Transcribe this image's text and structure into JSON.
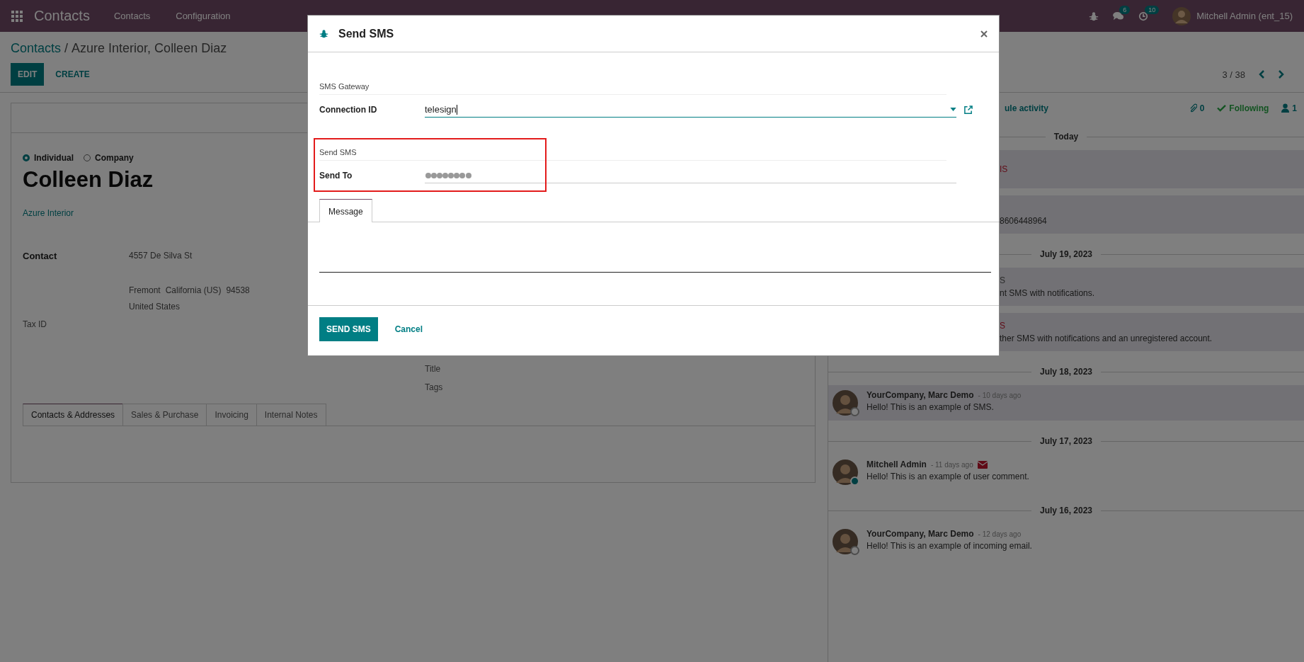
{
  "navbar": {
    "app_name": "Contacts",
    "menus": [
      "Contacts",
      "Configuration"
    ],
    "messages_count": "6",
    "activities_count": "10",
    "user_name": "Mitchell Admin (ent_15)"
  },
  "breadcrumb": {
    "parent": "Contacts",
    "separator": "/",
    "current": "Azure Interior, Colleen Diaz"
  },
  "actions": [
    {
      "label": "EDIT",
      "kind": "primary"
    },
    {
      "label": "CREATE",
      "kind": "link"
    }
  ],
  "pager": {
    "text": "3 / 38"
  },
  "form": {
    "company_type": [
      {
        "label": "Individual",
        "selected": true
      },
      {
        "label": "Company",
        "selected": false
      }
    ],
    "name": "Colleen Diaz",
    "parent_company": "Azure Interior",
    "address_label": "Contact",
    "address": {
      "street": "4557 De Silva St",
      "city": "Fremont",
      "state": "California (US)",
      "zip": "94538",
      "country": "United States"
    },
    "tax_label": "Tax ID",
    "right_labels": [
      "Title",
      "Tags"
    ],
    "tabs": [
      {
        "label": "Contacts & Addresses",
        "selected": true
      },
      {
        "label": "Sales & Purchase",
        "selected": false
      },
      {
        "label": "Invoicing",
        "selected": false
      },
      {
        "label": "Internal Notes",
        "selected": false
      }
    ]
  },
  "chatter": {
    "action_fragment": "ule activity",
    "attachments": "0",
    "follow_label": "Following",
    "followers": "1",
    "groups": [
      {
        "date": "Today",
        "messages": [
          {
            "kind": "fragment",
            "author_fragment": "IS",
            "failed": true,
            "shaded": true
          },
          {
            "kind": "fragment",
            "body_fragment": "8606448964",
            "shaded": true
          }
        ]
      },
      {
        "date": "July 19, 2023",
        "messages": [
          {
            "kind": "fragment",
            "author_fragment": "S",
            "failed": false,
            "body_fragment": "nt SMS with notifications.",
            "shaded": true
          },
          {
            "kind": "fragment",
            "author_fragment": "S",
            "failed": true,
            "body_fragment": "ther SMS with notifications and an unregistered account.",
            "shaded": true
          }
        ]
      },
      {
        "date": "July 18, 2023",
        "messages": [
          {
            "kind": "message",
            "author": "YourCompany, Marc Demo",
            "date": "- 10 days ago",
            "body": "Hello! This is an example of SMS.",
            "online": false,
            "shaded": true
          }
        ]
      },
      {
        "date": "July 17, 2023",
        "messages": [
          {
            "kind": "message",
            "author": "Mitchell Admin",
            "date": "- 11 days ago",
            "body": "Hello! This is an example of user comment.",
            "online": true,
            "envelope": true,
            "shaded": false
          }
        ]
      },
      {
        "date": "July 16, 2023",
        "messages": [
          {
            "kind": "message",
            "author": "YourCompany, Marc Demo",
            "date": "- 12 days ago",
            "body": "Hello! This is an example of incoming email.",
            "online": false,
            "shaded": false
          }
        ]
      }
    ]
  },
  "dialog": {
    "title": "Send SMS",
    "sections": [
      {
        "title": "SMS Gateway",
        "label": "Connection ID",
        "kind": "many2one",
        "value": "telesign"
      },
      {
        "title": "Send SMS",
        "label": "Send To",
        "kind": "redacted",
        "highlighted": true
      }
    ],
    "tabs": [
      {
        "label": "Message",
        "selected": true
      }
    ],
    "buttons": [
      {
        "label": "SEND SMS",
        "kind": "primary"
      },
      {
        "label": "Cancel",
        "kind": "link"
      }
    ]
  }
}
